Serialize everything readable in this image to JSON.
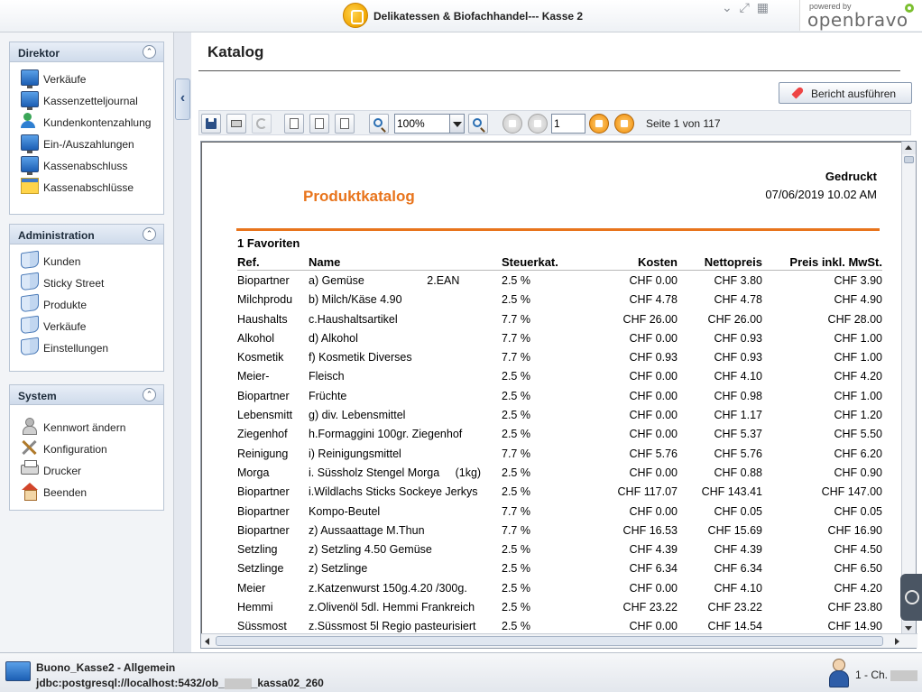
{
  "header": {
    "title": "Delikatessen & Biofachhandel--- Kasse 2",
    "brand_powered": "powered by",
    "brand_name": "openbravo"
  },
  "sidebar": {
    "sections": [
      {
        "title": "Direktor",
        "items": [
          {
            "label": "Verkäufe",
            "icon": "monitor-icon"
          },
          {
            "label": "Kassenzetteljournal",
            "icon": "monitor-icon"
          },
          {
            "label": "Kundenkontenzahlung",
            "icon": "users-icon"
          },
          {
            "label": "Ein-/Auszahlungen",
            "icon": "monitor-icon"
          },
          {
            "label": "Kassenabschluss",
            "icon": "monitor-icon"
          },
          {
            "label": "Kassenabschlüsse",
            "icon": "window-icon"
          }
        ]
      },
      {
        "title": "Administration",
        "items": [
          {
            "label": "Kunden",
            "icon": "book-icon"
          },
          {
            "label": "Sticky Street",
            "icon": "book-icon"
          },
          {
            "label": "Produkte",
            "icon": "book-icon"
          },
          {
            "label": "Verkäufe",
            "icon": "book-icon"
          },
          {
            "label": "Einstellungen",
            "icon": "book-icon"
          }
        ]
      },
      {
        "title": "System",
        "items": [
          {
            "label": "Kennwort ändern",
            "icon": "person-icon"
          },
          {
            "label": "Konfiguration",
            "icon": "tools-icon"
          },
          {
            "label": "Drucker",
            "icon": "printer-icon"
          },
          {
            "label": "Beenden",
            "icon": "home-icon"
          }
        ]
      }
    ]
  },
  "main": {
    "title": "Katalog",
    "run_button": "Bericht ausführen",
    "toolbar": {
      "zoom": "100%",
      "page_input": "1",
      "page_info": "Seite 1 von 117"
    }
  },
  "report": {
    "printed_label": "Gedruckt",
    "printed_date": "07/06/2019 10.02 AM",
    "title": "Produktkatalog",
    "group": "1 Favoriten",
    "columns": [
      "Ref.",
      "Name",
      "Steuerkat.",
      "Kosten",
      "Nettopreis",
      "Preis inkl. MwSt."
    ],
    "rows": [
      [
        "Biopartner",
        "a) Gemüse                    2.EAN",
        "2.5 %",
        "CHF 0.00",
        "CHF 3.80",
        "CHF 3.90"
      ],
      [
        "Milchprodu",
        "b) Milch/Käse 4.90",
        "2.5 %",
        "CHF 4.78",
        "CHF 4.78",
        "CHF 4.90"
      ],
      [
        "Haushalts",
        "c.Haushaltsartikel",
        "7.7 %",
        "CHF 26.00",
        "CHF 26.00",
        "CHF 28.00"
      ],
      [
        "Alkohol",
        "d) Alkohol",
        "7.7 %",
        "CHF 0.00",
        "CHF 0.93",
        "CHF 1.00"
      ],
      [
        "Kosmetik",
        "f) Kosmetik Diverses",
        "7.7 %",
        "CHF 0.93",
        "CHF 0.93",
        "CHF 1.00"
      ],
      [
        "Meier-",
        "Fleisch",
        "2.5 %",
        "CHF 0.00",
        "CHF 4.10",
        "CHF 4.20"
      ],
      [
        "Biopartner",
        "Früchte",
        "2.5 %",
        "CHF 0.00",
        "CHF 0.98",
        "CHF 1.00"
      ],
      [
        "Lebensmitt",
        "g) div. Lebensmittel",
        "2.5 %",
        "CHF 0.00",
        "CHF 1.17",
        "CHF 1.20"
      ],
      [
        "Ziegenhof",
        "h.Formaggini 100gr. Ziegenhof",
        "2.5 %",
        "CHF 0.00",
        "CHF 5.37",
        "CHF 5.50"
      ],
      [
        "Reinigung",
        "i) Reinigungsmittel",
        "7.7 %",
        "CHF 5.76",
        "CHF 5.76",
        "CHF 6.20"
      ],
      [
        "Morga",
        "i. Süssholz Stengel Morga     (1kg)",
        "2.5 %",
        "CHF 0.00",
        "CHF 0.88",
        "CHF 0.90"
      ],
      [
        "Biopartner",
        "i.Wildlachs Sticks Sockeye Jerkys",
        "2.5 %",
        "CHF 117.07",
        "CHF 143.41",
        "CHF 147.00"
      ],
      [
        "Biopartner",
        "Kompo-Beutel",
        "7.7 %",
        "CHF 0.00",
        "CHF 0.05",
        "CHF 0.05"
      ],
      [
        "Biopartner",
        "z) Aussaattage M.Thun",
        "7.7 %",
        "CHF 16.53",
        "CHF 15.69",
        "CHF 16.90"
      ],
      [
        "Setzling",
        "z) Setzling 4.50 Gemüse",
        "2.5 %",
        "CHF 4.39",
        "CHF 4.39",
        "CHF 4.50"
      ],
      [
        "Setzlinge",
        "z) Setzlinge",
        "2.5 %",
        "CHF 6.34",
        "CHF 6.34",
        "CHF 6.50"
      ],
      [
        "Meier",
        "z.Katzenwurst 150g.4.20 /300g.",
        "2.5 %",
        "CHF 0.00",
        "CHF 4.10",
        "CHF 4.20"
      ],
      [
        "Hemmi",
        "z.Olivenöl 5dl. Hemmi Frankreich",
        "2.5 %",
        "CHF 23.22",
        "CHF 23.22",
        "CHF 23.80"
      ],
      [
        "Süssmost",
        "z.Süssmost 5l Regio pasteurisiert",
        "2.5 %",
        "CHF 0.00",
        "CHF 14.54",
        "CHF 14.90"
      ]
    ]
  },
  "status": {
    "line1": "Buono_Kasse2 - Allgemein",
    "line2_prefix": "jdbc:postgresql://localhost:5432/ob_",
    "line2_suffix": "_kassa02_260",
    "user_prefix": "1 - Ch."
  }
}
